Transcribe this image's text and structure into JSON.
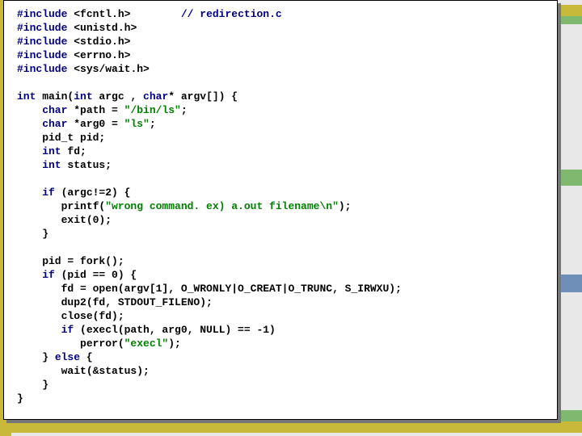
{
  "code": {
    "includes": [
      {
        "keyword": "#include",
        "header": "<fcntl.h>",
        "comment": "// redirection.c"
      },
      {
        "keyword": "#include",
        "header": "<unistd.h>",
        "comment": ""
      },
      {
        "keyword": "#include",
        "header": "<stdio.h>",
        "comment": ""
      },
      {
        "keyword": "#include",
        "header": "<errno.h>",
        "comment": ""
      },
      {
        "keyword": "#include",
        "header": "<sys/wait.h>",
        "comment": ""
      }
    ],
    "main_sig_1": "int",
    "main_sig_2": " main(",
    "main_sig_3": "int",
    "main_sig_4": " argc , ",
    "main_sig_5": "char",
    "main_sig_6": "* argv[]) {",
    "decl1_a": "    char",
    "decl1_b": " *path = ",
    "decl1_c": "\"/bin/ls\"",
    "decl1_d": ";",
    "decl2_a": "    char",
    "decl2_b": " *arg0 = ",
    "decl2_c": "\"ls\"",
    "decl2_d": ";",
    "decl3": "    pid_t pid;",
    "decl4_a": "    int",
    "decl4_b": " fd;",
    "decl5_a": "    int",
    "decl5_b": " status;",
    "blank1": "",
    "if1_a": "    if",
    "if1_b": " (argc!=2) {",
    "printf_a": "       printf(",
    "printf_b": "\"wrong command. ex) a.out filename\\n\"",
    "printf_c": ");",
    "exit_line": "       exit(0);",
    "if1_end": "    }",
    "blank2": "",
    "fork_line": "    pid = fork();",
    "if2_a": "    if",
    "if2_b": " (pid == 0) {",
    "open_line": "       fd = open(argv[1], O_WRONLY|O_CREAT|O_TRUNC, S_IRWXU);",
    "dup2_line": "       dup2(fd, STDOUT_FILENO);",
    "close_line": "       close(fd);",
    "if3_a": "       if",
    "if3_b": " (execl(path, arg0, NULL) == -1)",
    "perror_a": "          perror(",
    "perror_b": "\"execl\"",
    "perror_c": ");",
    "else_a": "    } ",
    "else_b": "else",
    "else_c": " {",
    "wait_line": "       wait(&status);",
    "else_end": "    }",
    "main_end": "}"
  }
}
